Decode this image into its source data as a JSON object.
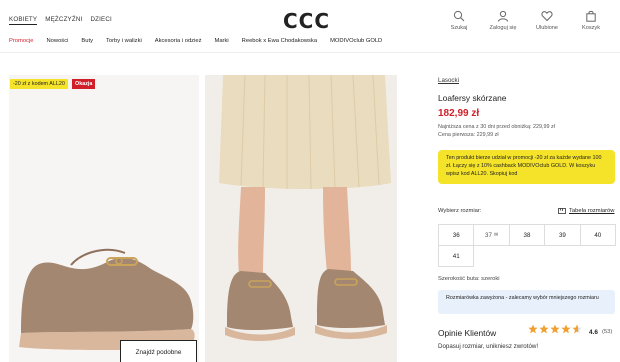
{
  "topnav": {
    "women": "KOBIETY",
    "men": "MĘŻCZYŹNI",
    "kids": "DZIECI"
  },
  "logo": "CCC",
  "icons": {
    "search": "Szukaj",
    "login": "Zaloguj się",
    "favorites": "Ulubione",
    "cart": "Koszyk"
  },
  "menu": [
    "Promocje",
    "Nowości",
    "Buty",
    "Torby i walizki",
    "Akcesoria i odzież",
    "Marki",
    "Reebok x Ewa Chodakowska",
    "MODIVOclub GOLD"
  ],
  "gallery": {
    "badge_promo": "-20 zł z kodem ALL20",
    "badge_deal": "Okazja",
    "find_similar": "Znajdź podobne"
  },
  "product": {
    "brand": "Lasocki",
    "name": "Loafersy skórzane",
    "price": "182,99 zł",
    "lowest_price": "Najniższa cena z 30 dni przed obniżką: 229,99 zł",
    "first_price": "Cena pierwsza: 229,99 zł",
    "promo_info": "Ten produkt bierze udział w promocji -20 zł za każde wydane 100 zł. Łączy się z 10% cashback MODIVOclub GOLD. W koszyku wpisz kod ALL20. Skopiuj kod"
  },
  "sizes": {
    "label": "Wybierz rozmiar:",
    "table_link": "Tabela rozmiarów",
    "options": [
      "36",
      "37",
      "38",
      "39",
      "40",
      "41"
    ]
  },
  "width": "Szerokość buta: szeroki",
  "fit_info": "Rozmiarówka zawyżona - zalecamy wybór mniejszego rozmiaru",
  "reviews": {
    "title": "Opinie Klientów",
    "rating": "4.6",
    "count": "(53)",
    "rating_value": 4.6
  },
  "returns": "Dopasuj rozmiar, unikniesz zwrotów!",
  "colors": {
    "accent_red": "#d11f2a",
    "promo_yellow": "#f5e32a",
    "info_blue": "#e8f0fb",
    "star": "#f0a030"
  }
}
